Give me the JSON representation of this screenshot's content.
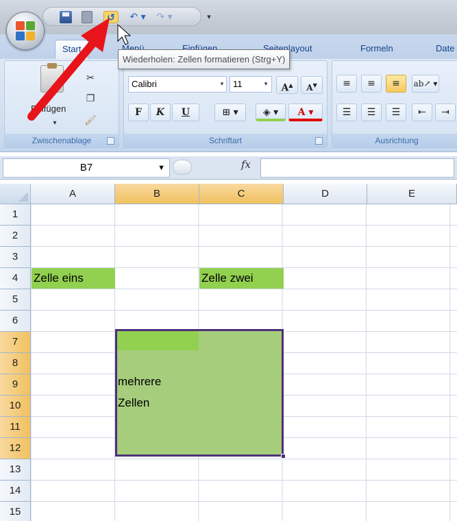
{
  "tabs": [
    {
      "label": "Start"
    },
    {
      "label": "Menü"
    },
    {
      "label": "Einfügen"
    },
    {
      "label": "Seitenlayout"
    },
    {
      "label": "Formeln"
    },
    {
      "label": "Date"
    }
  ],
  "tooltip": "Wiederholen: Zellen formatieren (Strg+Y)",
  "ribbon": {
    "clipboard": {
      "label": "Zwischenablage",
      "paste": "Einfügen"
    },
    "font": {
      "label": "Schriftart",
      "family": "Calibri",
      "size": "11",
      "bold": "F",
      "italic": "K",
      "underline": "U"
    },
    "alignment": {
      "label": "Ausrichtung"
    }
  },
  "formula_bar": {
    "name_box": "B7",
    "fx": "fx",
    "value": ""
  },
  "columns": [
    "A",
    "B",
    "C",
    "D",
    "E"
  ],
  "selected_columns": [
    "B",
    "C"
  ],
  "rows": [
    "1",
    "2",
    "3",
    "4",
    "5",
    "6",
    "7",
    "8",
    "9",
    "10",
    "11",
    "12",
    "13",
    "14",
    "15"
  ],
  "selected_rows": [
    "7",
    "8",
    "9",
    "10",
    "11",
    "12"
  ],
  "cells": {
    "A4": "Zelle eins",
    "C4": "Zelle zwei",
    "B9": "mehrere",
    "B10": "Zellen"
  },
  "colors": {
    "cell_fill": "#92d050",
    "selection_border": "#4b2f78",
    "arrow": "#e8141b"
  }
}
